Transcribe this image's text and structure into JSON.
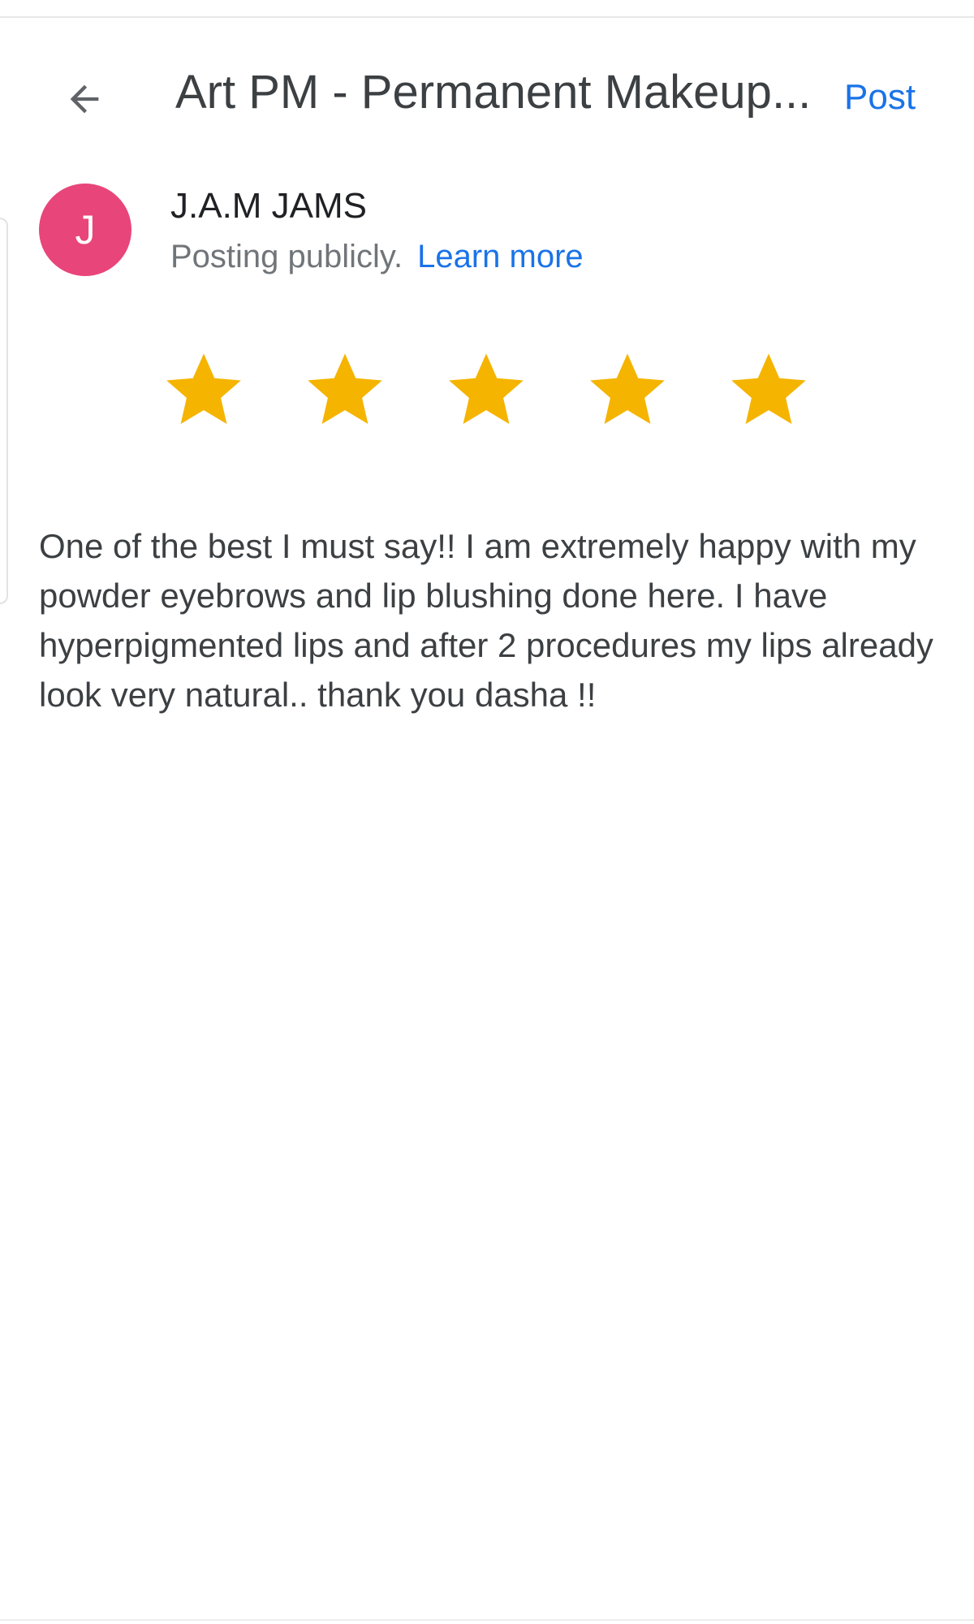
{
  "header": {
    "back_icon": "arrow-back-icon",
    "title": "Art PM - Permanent Makeup...",
    "post_label": "Post"
  },
  "author": {
    "avatar_initial": "J",
    "avatar_color": "#e8457a",
    "name": "J.A.M JAMS",
    "posting_text": "Posting publicly.",
    "learn_more_label": "Learn more"
  },
  "rating": {
    "value": 5,
    "max": 5,
    "star_color": "#f5b400",
    "icon": "star-icon"
  },
  "review": {
    "text": "One of the best I must say!! I am extremely happy with my powder eyebrows and lip blushing done here. I have hyperpigmented lips and after 2 procedures my lips already look very natural.. thank you dasha !!"
  },
  "colors": {
    "accent": "#1a73e8",
    "text_primary": "#202124",
    "text_secondary": "#70757a"
  }
}
